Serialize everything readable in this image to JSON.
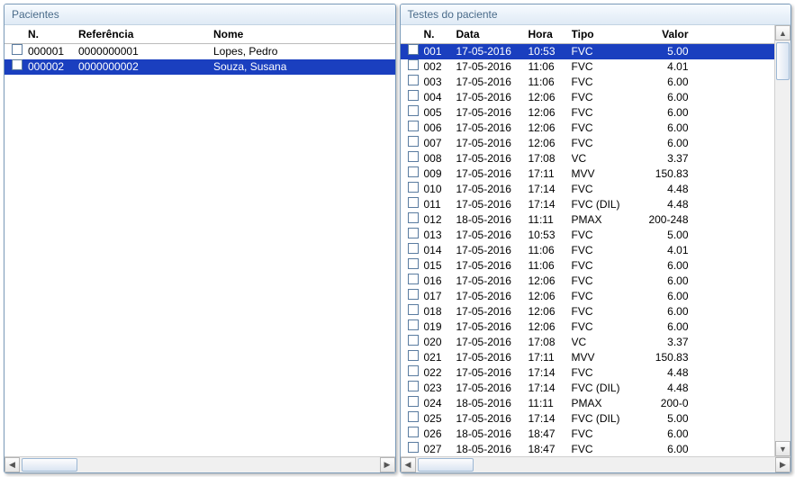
{
  "left": {
    "title": "Pacientes",
    "headers": {
      "n": "N.",
      "ref": "Referência",
      "nome": "Nome"
    },
    "rows": [
      {
        "n": "000001",
        "ref": "0000000001",
        "nome": "Lopes, Pedro",
        "selected": false
      },
      {
        "n": "000002",
        "ref": "0000000002",
        "nome": "Souza, Susana",
        "selected": true
      }
    ]
  },
  "right": {
    "title": "Testes do paciente",
    "headers": {
      "n": "N.",
      "data": "Data",
      "hora": "Hora",
      "tipo": "Tipo",
      "valor": "Valor"
    },
    "rows": [
      {
        "n": "001",
        "data": "17-05-2016",
        "hora": "10:53",
        "tipo": "FVC",
        "valor": "5.00",
        "selected": true
      },
      {
        "n": "002",
        "data": "17-05-2016",
        "hora": "11:06",
        "tipo": "FVC",
        "valor": "4.01"
      },
      {
        "n": "003",
        "data": "17-05-2016",
        "hora": "11:06",
        "tipo": "FVC",
        "valor": "6.00"
      },
      {
        "n": "004",
        "data": "17-05-2016",
        "hora": "12:06",
        "tipo": "FVC",
        "valor": "6.00"
      },
      {
        "n": "005",
        "data": "17-05-2016",
        "hora": "12:06",
        "tipo": "FVC",
        "valor": "6.00"
      },
      {
        "n": "006",
        "data": "17-05-2016",
        "hora": "12:06",
        "tipo": "FVC",
        "valor": "6.00"
      },
      {
        "n": "007",
        "data": "17-05-2016",
        "hora": "12:06",
        "tipo": "FVC",
        "valor": "6.00"
      },
      {
        "n": "008",
        "data": "17-05-2016",
        "hora": "17:08",
        "tipo": "VC",
        "valor": "3.37"
      },
      {
        "n": "009",
        "data": "17-05-2016",
        "hora": "17:11",
        "tipo": "MVV",
        "valor": "150.83"
      },
      {
        "n": "010",
        "data": "17-05-2016",
        "hora": "17:14",
        "tipo": "FVC",
        "valor": "4.48"
      },
      {
        "n": "011",
        "data": "17-05-2016",
        "hora": "17:14",
        "tipo": "FVC (DIL)",
        "valor": "4.48"
      },
      {
        "n": "012",
        "data": "18-05-2016",
        "hora": "11:11",
        "tipo": "PMAX",
        "valor": "200-248"
      },
      {
        "n": "013",
        "data": "17-05-2016",
        "hora": "10:53",
        "tipo": "FVC",
        "valor": "5.00"
      },
      {
        "n": "014",
        "data": "17-05-2016",
        "hora": "11:06",
        "tipo": "FVC",
        "valor": "4.01"
      },
      {
        "n": "015",
        "data": "17-05-2016",
        "hora": "11:06",
        "tipo": "FVC",
        "valor": "6.00"
      },
      {
        "n": "016",
        "data": "17-05-2016",
        "hora": "12:06",
        "tipo": "FVC",
        "valor": "6.00"
      },
      {
        "n": "017",
        "data": "17-05-2016",
        "hora": "12:06",
        "tipo": "FVC",
        "valor": "6.00"
      },
      {
        "n": "018",
        "data": "17-05-2016",
        "hora": "12:06",
        "tipo": "FVC",
        "valor": "6.00"
      },
      {
        "n": "019",
        "data": "17-05-2016",
        "hora": "12:06",
        "tipo": "FVC",
        "valor": "6.00"
      },
      {
        "n": "020",
        "data": "17-05-2016",
        "hora": "17:08",
        "tipo": "VC",
        "valor": "3.37"
      },
      {
        "n": "021",
        "data": "17-05-2016",
        "hora": "17:11",
        "tipo": "MVV",
        "valor": "150.83"
      },
      {
        "n": "022",
        "data": "17-05-2016",
        "hora": "17:14",
        "tipo": "FVC",
        "valor": "4.48"
      },
      {
        "n": "023",
        "data": "17-05-2016",
        "hora": "17:14",
        "tipo": "FVC (DIL)",
        "valor": "4.48"
      },
      {
        "n": "024",
        "data": "18-05-2016",
        "hora": "11:11",
        "tipo": "PMAX",
        "valor": "200-0"
      },
      {
        "n": "025",
        "data": "17-05-2016",
        "hora": "17:14",
        "tipo": "FVC (DIL)",
        "valor": "5.00"
      },
      {
        "n": "026",
        "data": "18-05-2016",
        "hora": "18:47",
        "tipo": "FVC",
        "valor": "6.00"
      },
      {
        "n": "027",
        "data": "18-05-2016",
        "hora": "18:47",
        "tipo": "FVC",
        "valor": "6.00"
      }
    ]
  }
}
